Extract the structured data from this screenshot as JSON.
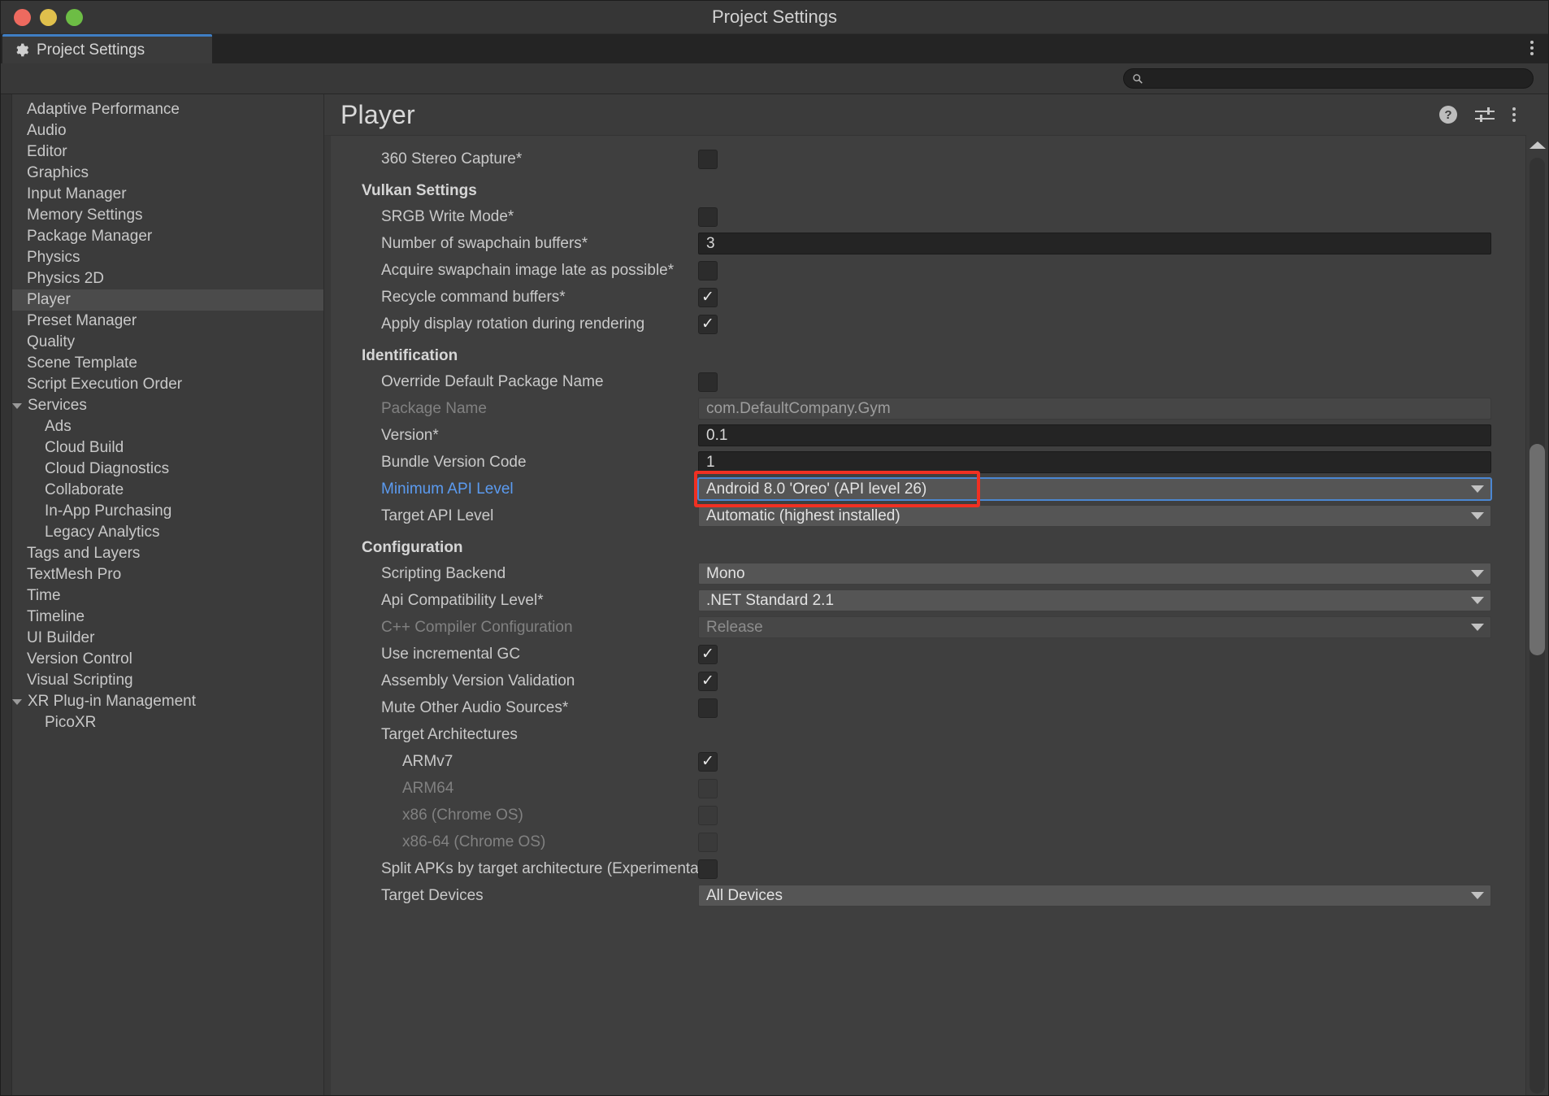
{
  "window": {
    "title": "Project Settings",
    "tab_label": "Project Settings",
    "tab_icon": "gear-icon",
    "menu_icon": "kebab-menu-icon"
  },
  "search": {
    "placeholder": "",
    "value": "",
    "icon": "search-icon"
  },
  "sidebar": {
    "items": [
      {
        "label": "Adaptive Performance",
        "level": 0,
        "selected": false,
        "expandable": false
      },
      {
        "label": "Audio",
        "level": 0,
        "selected": false,
        "expandable": false
      },
      {
        "label": "Editor",
        "level": 0,
        "selected": false,
        "expandable": false
      },
      {
        "label": "Graphics",
        "level": 0,
        "selected": false,
        "expandable": false
      },
      {
        "label": "Input Manager",
        "level": 0,
        "selected": false,
        "expandable": false
      },
      {
        "label": "Memory Settings",
        "level": 0,
        "selected": false,
        "expandable": false
      },
      {
        "label": "Package Manager",
        "level": 0,
        "selected": false,
        "expandable": false
      },
      {
        "label": "Physics",
        "level": 0,
        "selected": false,
        "expandable": false
      },
      {
        "label": "Physics 2D",
        "level": 0,
        "selected": false,
        "expandable": false
      },
      {
        "label": "Player",
        "level": 0,
        "selected": true,
        "expandable": false
      },
      {
        "label": "Preset Manager",
        "level": 0,
        "selected": false,
        "expandable": false
      },
      {
        "label": "Quality",
        "level": 0,
        "selected": false,
        "expandable": false
      },
      {
        "label": "Scene Template",
        "level": 0,
        "selected": false,
        "expandable": false
      },
      {
        "label": "Script Execution Order",
        "level": 0,
        "selected": false,
        "expandable": false
      },
      {
        "label": "Services",
        "level": 0,
        "selected": false,
        "expandable": true
      },
      {
        "label": "Ads",
        "level": 1,
        "selected": false,
        "expandable": false
      },
      {
        "label": "Cloud Build",
        "level": 1,
        "selected": false,
        "expandable": false
      },
      {
        "label": "Cloud Diagnostics",
        "level": 1,
        "selected": false,
        "expandable": false
      },
      {
        "label": "Collaborate",
        "level": 1,
        "selected": false,
        "expandable": false
      },
      {
        "label": "In-App Purchasing",
        "level": 1,
        "selected": false,
        "expandable": false
      },
      {
        "label": "Legacy Analytics",
        "level": 1,
        "selected": false,
        "expandable": false
      },
      {
        "label": "Tags and Layers",
        "level": 0,
        "selected": false,
        "expandable": false
      },
      {
        "label": "TextMesh Pro",
        "level": 0,
        "selected": false,
        "expandable": false
      },
      {
        "label": "Time",
        "level": 0,
        "selected": false,
        "expandable": false
      },
      {
        "label": "Timeline",
        "level": 0,
        "selected": false,
        "expandable": false
      },
      {
        "label": "UI Builder",
        "level": 0,
        "selected": false,
        "expandable": false
      },
      {
        "label": "Version Control",
        "level": 0,
        "selected": false,
        "expandable": false
      },
      {
        "label": "Visual Scripting",
        "level": 0,
        "selected": false,
        "expandable": false
      },
      {
        "label": "XR Plug-in Management",
        "level": 0,
        "selected": false,
        "expandable": true
      },
      {
        "label": "PicoXR",
        "level": 1,
        "selected": false,
        "expandable": false
      }
    ]
  },
  "main": {
    "title": "Player",
    "header_icons": {
      "help": "help-icon",
      "preferences": "sliders-icon",
      "menu": "kebab-menu-icon"
    },
    "help_glyph": "?",
    "rows": [
      {
        "kind": "check",
        "label": "360 Stereo Capture*",
        "indent": 1,
        "checked": false,
        "disabled": false
      },
      {
        "kind": "header",
        "label": "Vulkan Settings"
      },
      {
        "kind": "check",
        "label": "SRGB Write Mode*",
        "indent": 1,
        "checked": false,
        "disabled": false
      },
      {
        "kind": "text",
        "label": "Number of swapchain buffers*",
        "indent": 1,
        "value": "3",
        "readonly": false
      },
      {
        "kind": "check",
        "label": "Acquire swapchain image late as possible*",
        "indent": 1,
        "checked": false,
        "disabled": false
      },
      {
        "kind": "check",
        "label": "Recycle command buffers*",
        "indent": 1,
        "checked": true,
        "disabled": false
      },
      {
        "kind": "check",
        "label": "Apply display rotation during rendering",
        "indent": 1,
        "checked": true,
        "disabled": false
      },
      {
        "kind": "header",
        "label": "Identification"
      },
      {
        "kind": "check",
        "label": "Override Default Package Name",
        "indent": 1,
        "checked": false,
        "disabled": false
      },
      {
        "kind": "text",
        "label": "Package Name",
        "indent": 1,
        "value": "com.DefaultCompany.Gym",
        "readonly": true,
        "label_dim": true
      },
      {
        "kind": "text",
        "label": "Version*",
        "indent": 1,
        "value": "0.1",
        "readonly": false
      },
      {
        "kind": "text",
        "label": "Bundle Version Code",
        "indent": 1,
        "value": "1",
        "readonly": false
      },
      {
        "kind": "select",
        "label": "Minimum API Level",
        "indent": 1,
        "value": "Android 8.0 'Oreo' (API level 26)",
        "label_link": true,
        "focused": true,
        "annotated": true
      },
      {
        "kind": "select",
        "label": "Target API Level",
        "indent": 1,
        "value": "Automatic (highest installed)"
      },
      {
        "kind": "header",
        "label": "Configuration"
      },
      {
        "kind": "select",
        "label": "Scripting Backend",
        "indent": 1,
        "value": "Mono"
      },
      {
        "kind": "select",
        "label": "Api Compatibility Level*",
        "indent": 1,
        "value": ".NET Standard 2.1"
      },
      {
        "kind": "select",
        "label": "C++ Compiler Configuration",
        "indent": 1,
        "value": "Release",
        "disabled": true,
        "label_dim": true
      },
      {
        "kind": "check",
        "label": "Use incremental GC",
        "indent": 1,
        "checked": true,
        "disabled": false
      },
      {
        "kind": "check",
        "label": "Assembly Version Validation",
        "indent": 1,
        "checked": true,
        "disabled": false
      },
      {
        "kind": "check",
        "label": "Mute Other Audio Sources*",
        "indent": 1,
        "checked": false,
        "disabled": false
      },
      {
        "kind": "plain",
        "label": "Target Architectures",
        "indent": 1
      },
      {
        "kind": "check",
        "label": "ARMv7",
        "indent": 2,
        "checked": true,
        "disabled": false
      },
      {
        "kind": "check",
        "label": "ARM64",
        "indent": 2,
        "checked": false,
        "disabled": true,
        "label_dim": true
      },
      {
        "kind": "check",
        "label": "x86 (Chrome OS)",
        "indent": 2,
        "checked": false,
        "disabled": true,
        "label_dim": true
      },
      {
        "kind": "check",
        "label": "x86-64 (Chrome OS)",
        "indent": 2,
        "checked": false,
        "disabled": true,
        "label_dim": true
      },
      {
        "kind": "check",
        "label": "Split APKs by target architecture (Experimental)",
        "indent": 1,
        "checked": false,
        "disabled": false
      },
      {
        "kind": "select",
        "label": "Target Devices",
        "indent": 1,
        "value": "All Devices"
      }
    ]
  },
  "colors": {
    "accent_blue": "#4b87d2",
    "link_blue": "#5b9bf0",
    "annotation_red": "#f03022",
    "panel_bg": "#3f3f3f",
    "sidebar_bg": "#3b3b3b",
    "selected_row": "#4b4b4b"
  }
}
